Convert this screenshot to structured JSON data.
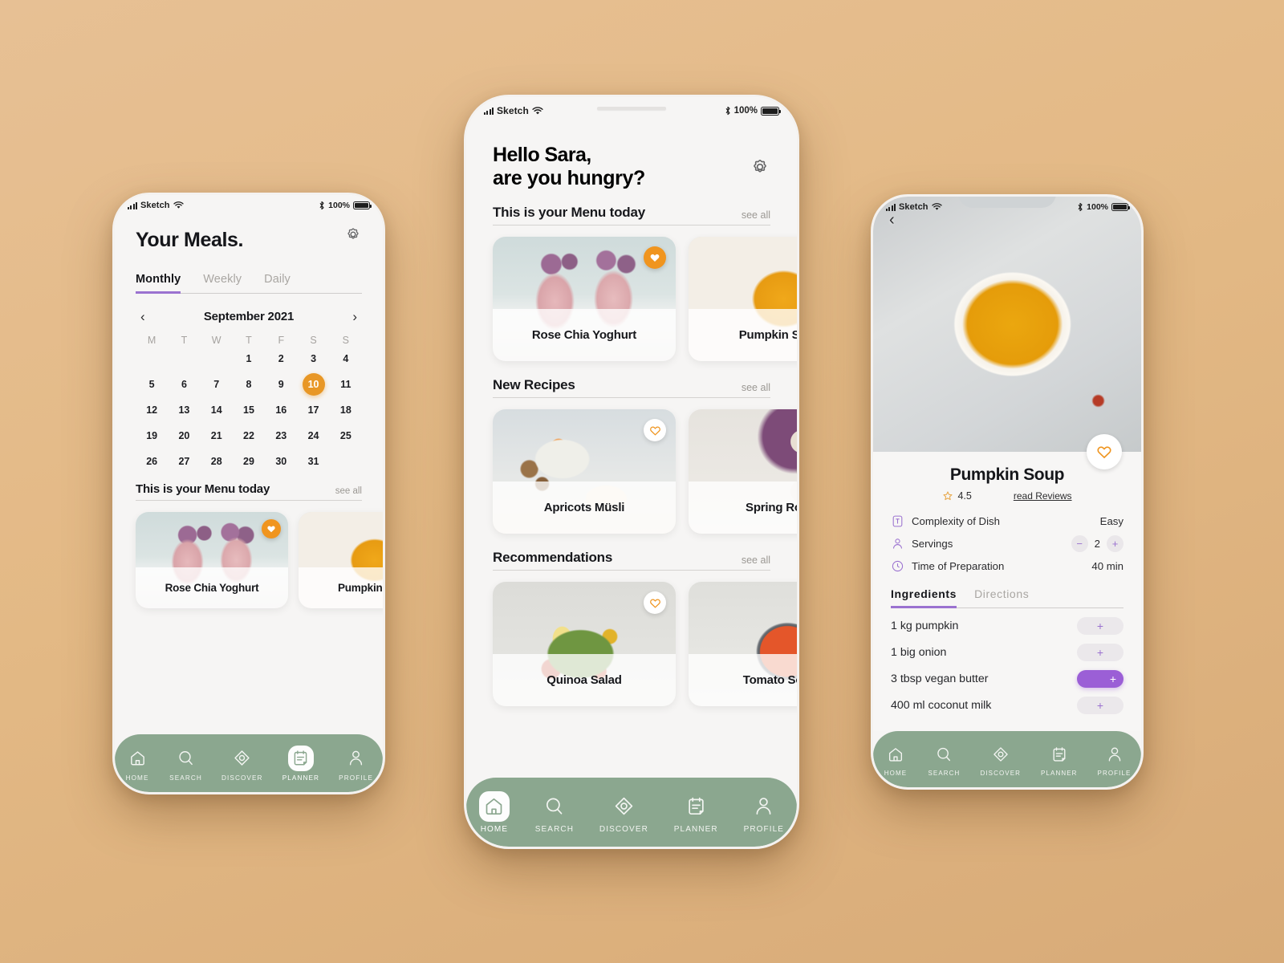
{
  "theme": {
    "page_background": "#e3b985",
    "sage_green": "#8ba78f",
    "purple_accent": "#9b72d0",
    "purple_pill": "#9b5fd6",
    "orange_accent": "#e89726",
    "heart_orange": "#f0951f"
  },
  "status_bar": {
    "carrier": "Sketch",
    "battery_percent": "100%"
  },
  "nav": {
    "items": [
      {
        "label": "HOME",
        "icon": "home-icon"
      },
      {
        "label": "SEARCH",
        "icon": "search-icon"
      },
      {
        "label": "DISCOVER",
        "icon": "discover-icon"
      },
      {
        "label": "PLANNER",
        "icon": "planner-icon"
      },
      {
        "label": "PROFILE",
        "icon": "profile-icon"
      }
    ]
  },
  "phone1": {
    "title": "Your Meals.",
    "settings_icon": "gear-icon",
    "tabs": [
      {
        "label": "Monthly",
        "active": true
      },
      {
        "label": "Weekly",
        "active": false
      },
      {
        "label": "Daily",
        "active": false
      }
    ],
    "calendar": {
      "month": "September 2021",
      "prev_icon": "chevron-left-icon",
      "next_icon": "chevron-right-icon",
      "day_initials": [
        "M",
        "T",
        "W",
        "T",
        "F",
        "S",
        "S"
      ],
      "first_day_column": 3,
      "days_in_month": 31,
      "selected_day": 10
    },
    "menu_section": {
      "title": "This is your Menu today",
      "see_all": "see all"
    },
    "cards": [
      {
        "title": "Rose Chia Yoghurt",
        "favorite": true,
        "heart_style": "filled"
      },
      {
        "title": "Pumpkin Soup",
        "favorite": false,
        "heart_style": "none"
      }
    ],
    "active_nav": "PLANNER"
  },
  "phone2": {
    "greeting_line1": "Hello Sara,",
    "greeting_line2": "are you hungry?",
    "settings_icon": "gear-icon",
    "sections": [
      {
        "title": "This is your Menu today",
        "see_all": "see all",
        "cards": [
          {
            "title": "Rose Chia Yoghurt",
            "heart_style": "filled"
          },
          {
            "title": "Pumpkin Soup",
            "heart_style": "none"
          }
        ]
      },
      {
        "title": "New Recipes",
        "see_all": "see all",
        "cards": [
          {
            "title": "Apricots Müsli",
            "heart_style": "outline"
          },
          {
            "title": "Spring Rolls",
            "heart_style": "none"
          }
        ]
      },
      {
        "title": "Recommendations",
        "see_all": "see all",
        "cards": [
          {
            "title": "Quinoa Salad",
            "heart_style": "outline"
          },
          {
            "title": "Tomato Soup",
            "heart_style": "none"
          }
        ]
      }
    ],
    "active_nav": "HOME"
  },
  "phone3": {
    "back_icon": "chevron-left-icon",
    "favorite_icon": "heart-outline-icon",
    "title": "Pumpkin Soup",
    "rating": "4.5",
    "rating_icon": "star-icon",
    "reviews_link": "read Reviews",
    "meta": [
      {
        "icon": "complexity-icon",
        "label": "Complexity of Dish",
        "value": "Easy",
        "type": "text"
      },
      {
        "icon": "person-icon",
        "label": "Servings",
        "value": "2",
        "type": "stepper",
        "minus": "−",
        "plus": "+"
      },
      {
        "icon": "clock-icon",
        "label": "Time of Preparation",
        "value": "40 min",
        "type": "text"
      }
    ],
    "tabs": [
      {
        "label": "Ingredients",
        "active": true
      },
      {
        "label": "Directions",
        "active": false
      }
    ],
    "ingredients": [
      {
        "name": "1 kg pumpkin",
        "add": "+",
        "added": false
      },
      {
        "name": "1 big onion",
        "add": "+",
        "added": false
      },
      {
        "name": "3 tbsp vegan butter",
        "add": "+",
        "added": true
      },
      {
        "name": "400 ml coconut milk",
        "add": "+",
        "added": false
      }
    ],
    "active_nav": ""
  }
}
